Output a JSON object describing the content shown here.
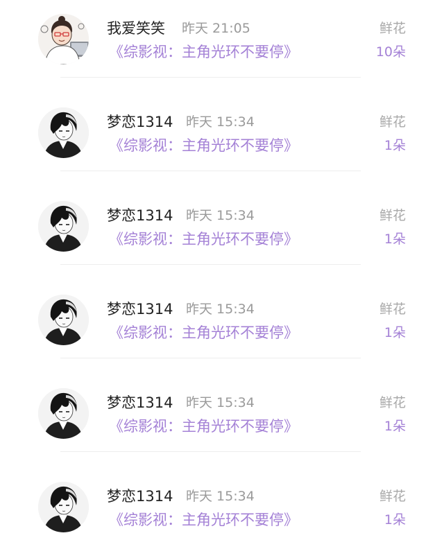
{
  "records": [
    {
      "user": "我爱笑笑",
      "time": "昨天 21:05",
      "title": "《综影视：主角光环不要停》",
      "gift_type": "鲜花",
      "gift_count": "10朵",
      "avatar": "cartoon-girl-avatar"
    },
    {
      "user": "梦恋1314",
      "time": "昨天 15:34",
      "title": "《综影视：主角光环不要停》",
      "gift_type": "鲜花",
      "gift_count": "1朵",
      "avatar": "anime-boy-avatar"
    },
    {
      "user": "梦恋1314",
      "time": "昨天 15:34",
      "title": "《综影视：主角光环不要停》",
      "gift_type": "鲜花",
      "gift_count": "1朵",
      "avatar": "anime-boy-avatar"
    },
    {
      "user": "梦恋1314",
      "time": "昨天 15:34",
      "title": "《综影视：主角光环不要停》",
      "gift_type": "鲜花",
      "gift_count": "1朵",
      "avatar": "anime-boy-avatar"
    },
    {
      "user": "梦恋1314",
      "time": "昨天 15:34",
      "title": "《综影视：主角光环不要停》",
      "gift_type": "鲜花",
      "gift_count": "1朵",
      "avatar": "anime-boy-avatar"
    },
    {
      "user": "梦恋1314",
      "time": "昨天 15:34",
      "title": "《综影视：主角光环不要停》",
      "gift_type": "鲜花",
      "gift_count": "1朵",
      "avatar": "anime-boy-avatar"
    }
  ],
  "colors": {
    "accent": "#a481d6",
    "name": "#222222",
    "muted": "#9a9a9a",
    "divider": "#ededed"
  }
}
